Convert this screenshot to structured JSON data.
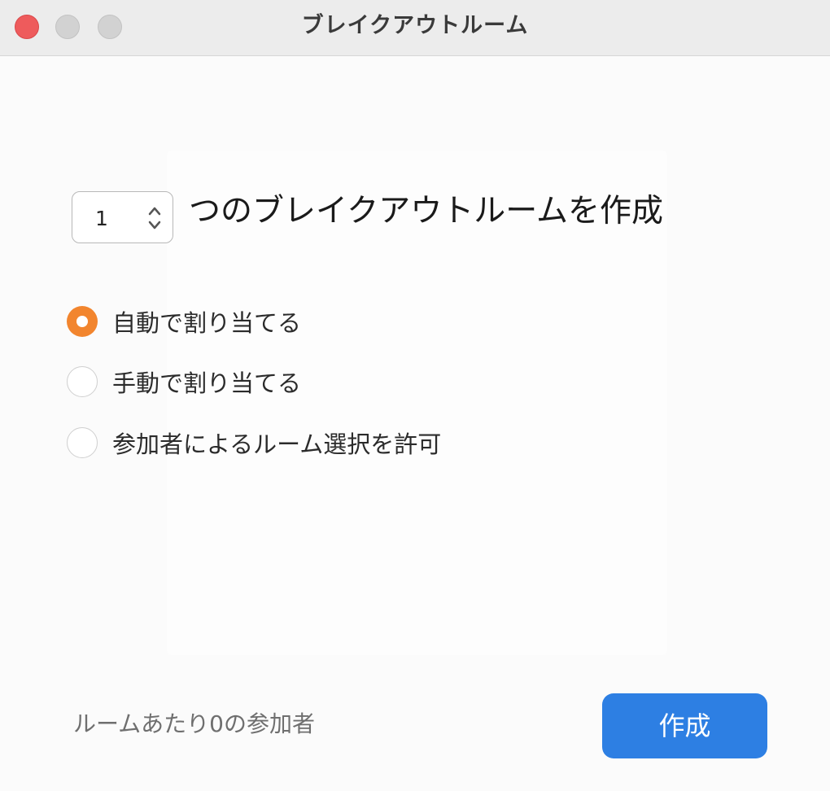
{
  "window": {
    "title": "ブレイクアウトルーム"
  },
  "room_count": {
    "value": "1",
    "suffix_label": "つのブレイクアウトルームを作成"
  },
  "assignment_options": [
    {
      "label": "自動で割り当てる",
      "selected": true
    },
    {
      "label": "手動で割り当てる",
      "selected": false
    },
    {
      "label": "参加者によるルーム選択を許可",
      "selected": false
    }
  ],
  "footer": {
    "participants_per_room": "ルームあたり0の参加者",
    "create_button": "作成"
  },
  "colors": {
    "accent_orange": "#f2852e",
    "button_blue": "#2d7fe3",
    "close_red": "#ee5b5c"
  },
  "icons": {
    "close": "close-icon",
    "minimize": "minimize-icon",
    "maximize": "maximize-icon",
    "stepper": "up-down-chevron-icon"
  }
}
